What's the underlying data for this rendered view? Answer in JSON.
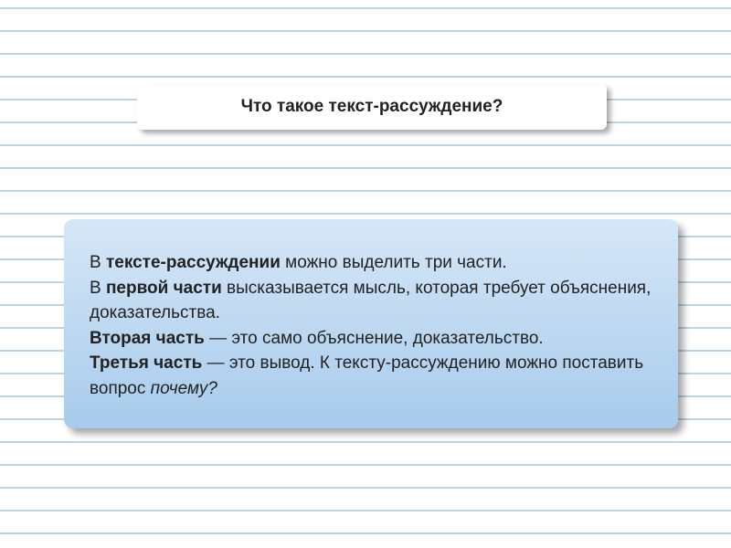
{
  "title": "Что такое текст-рассуждение?",
  "body": {
    "line1_prefix": "В ",
    "line1_bold": "тексте-рассуждении",
    "line1_rest": " можно выделить три части.",
    "line2_prefix": "В ",
    "line2_bold": "первой части",
    "line2_rest": " высказывается мысль, которая требует объяснения, доказательства.",
    "line3_bold": "Вторая часть",
    "line3_rest": " — это само объяснение, доказательство.",
    "line4_bold": "Третья часть",
    "line4_rest": " — это вывод. К тексту-рассуждению можно поставить вопрос ",
    "line4_italic": "почему?"
  }
}
